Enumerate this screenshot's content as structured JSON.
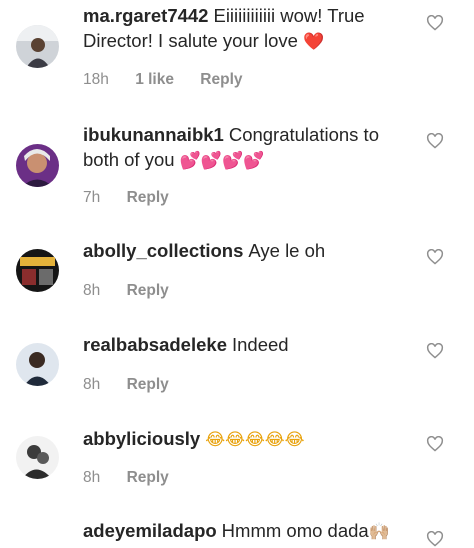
{
  "comments": [
    {
      "username": "ma.rgaret7442",
      "text": "Eiiiiiiiiiiii wow! True Director! I salute your love",
      "emoji": "❤️",
      "time": "18h",
      "likes": "1 like",
      "reply": "Reply"
    },
    {
      "username": "ibukunannaibk1",
      "text": "Congratulations to both of you",
      "emoji": "💕💕💕💕",
      "time": "7h",
      "reply": "Reply"
    },
    {
      "username": "abolly_collections",
      "text": "Aye le oh",
      "time": "8h",
      "reply": "Reply"
    },
    {
      "username": "realbabsadeleke",
      "text": "Indeed",
      "time": "8h",
      "reply": "Reply"
    },
    {
      "username": "abbyliciously",
      "text": "",
      "emoji": "😂😂😂😂😂",
      "time": "8h",
      "reply": "Reply"
    },
    {
      "username": "adeyemiladapo",
      "text": "Hmmm omo dada",
      "emoji": "🙌🏼"
    }
  ],
  "colors": {
    "text": "#262626",
    "meta": "#8e8e8e",
    "heart_outline": "#8e8e8e"
  },
  "icons": {
    "like": "heart-outline-icon"
  }
}
